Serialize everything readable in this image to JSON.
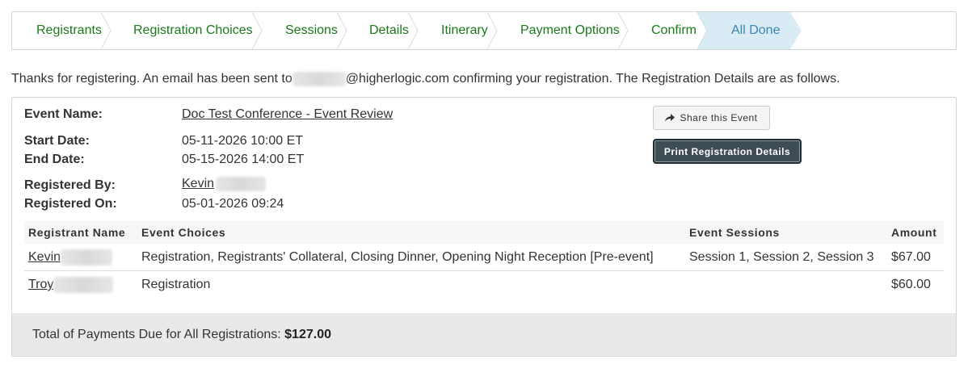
{
  "wizard": {
    "steps": [
      {
        "label": "Registrants"
      },
      {
        "label": "Registration Choices"
      },
      {
        "label": "Sessions"
      },
      {
        "label": "Details"
      },
      {
        "label": "Itinerary"
      },
      {
        "label": "Payment Options"
      },
      {
        "label": "Confirm"
      },
      {
        "label": "All Done"
      }
    ],
    "active_step": "All Done",
    "colors": {
      "link": "#1a7a1a",
      "active_bg": "#d9ecf6",
      "active_text": "#3d86b0"
    }
  },
  "intro": {
    "before_email": "Thanks for registering. An email has been sent to",
    "email_domain": "@higherlogic.com",
    "after_email": " confirming your registration. The Registration Details are as follows."
  },
  "details": {
    "event_name_label": "Event Name:",
    "event_name": "Doc Test Conference - Event Review",
    "start_date_label": "Start Date:",
    "start_date": "05-11-2026 10:00 ET",
    "end_date_label": "End Date:",
    "end_date": "05-15-2026 14:00 ET",
    "registered_by_label": "Registered By:",
    "registered_by": "Kevin",
    "registered_on_label": "Registered On:",
    "registered_on": "05-01-2026 09:24"
  },
  "actions": {
    "share_label": "Share this Event",
    "share_icon": "share-arrow-icon",
    "print_label": "Print Registration Details",
    "print_color": "#3e4c55"
  },
  "table": {
    "columns": [
      "Registrant Name",
      "Event Choices",
      "Event Sessions",
      "Amount"
    ],
    "rows": [
      {
        "name": "Kevin",
        "choices": "Registration, Registrants' Collateral, Closing Dinner, Opening Night Reception [Pre-event]",
        "sessions": "Session 1, Session 2, Session 3",
        "amount": "$67.00"
      },
      {
        "name": "Troy",
        "choices": "Registration",
        "sessions": "",
        "amount": "$60.00"
      }
    ]
  },
  "footer": {
    "total_label": "Total of Payments Due for All Registrations:",
    "total_value": "$127.00"
  }
}
